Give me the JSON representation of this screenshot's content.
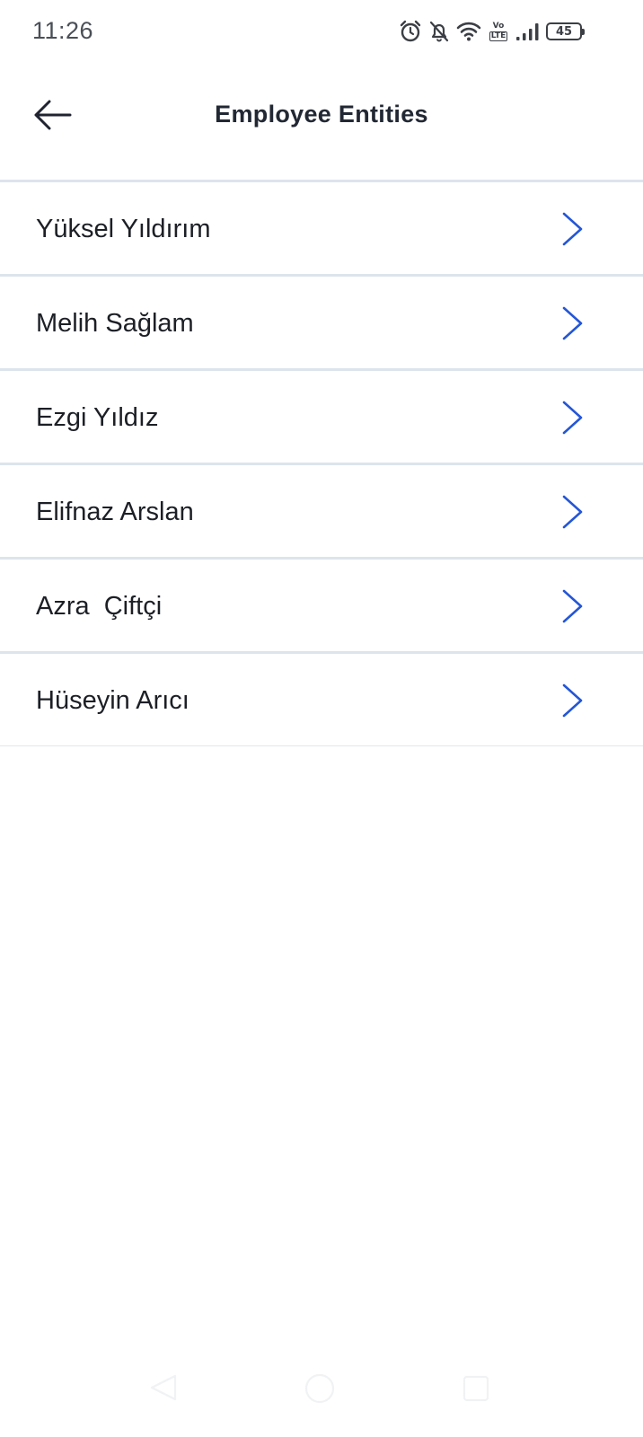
{
  "status_bar": {
    "time": "11:26",
    "icons": [
      "alarm-icon",
      "bell-off-icon",
      "wifi-icon",
      "volte-icon",
      "signal-icon",
      "battery-icon"
    ],
    "volte_top": "Vo",
    "volte_bottom": "LTE",
    "battery_level": "45"
  },
  "header": {
    "title": "Employee Entities",
    "back_icon": "arrow-left-icon"
  },
  "list": {
    "items": [
      {
        "label": "Yüksel Yıldırım"
      },
      {
        "label": "Melih Sağlam"
      },
      {
        "label": "Ezgi Yıldız"
      },
      {
        "label": "Elifnaz Arslan"
      },
      {
        "label": "Azra  Çiftçi"
      },
      {
        "label": "Hüseyin Arıcı"
      }
    ],
    "chevron_icon": "chevron-right-icon"
  },
  "nav_bar": {
    "icons": [
      "nav-back-icon",
      "nav-home-icon",
      "nav-recents-icon"
    ]
  },
  "colors": {
    "accent": "#2456d6",
    "divider": "#dde4ec",
    "text": "#1c1f26",
    "title": "#222833"
  }
}
